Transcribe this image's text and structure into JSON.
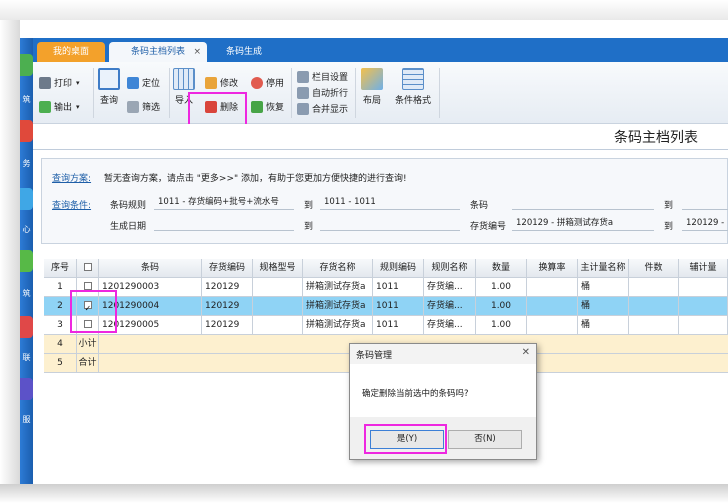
{
  "tabs": [
    {
      "label": "我的桌面"
    },
    {
      "label": "条码主档列表",
      "close": "×"
    },
    {
      "label": "条码生成"
    }
  ],
  "sidebar_chars": [
    "筑",
    "务",
    "心",
    "筑",
    "联",
    "服"
  ],
  "toolbar": {
    "print": "打印",
    "export": "输出",
    "query": "查询",
    "locate": "定位",
    "filter": "筛选",
    "import": "导入",
    "modify": "修改",
    "delete": "删除",
    "disable": "停用",
    "restore": "恢复",
    "column_settings": "栏目设置",
    "auto_wrap": "自动折行",
    "merge_display": "合并显示",
    "layout": "布局",
    "condition_format": "条件格式"
  },
  "page_title": "条码主档列表",
  "query": {
    "scheme_label": "查询方案:",
    "scheme_hint": "暂无查询方案，请点击 \"更多>>\" 添加，有助于您更加方便快捷的进行查询!",
    "condition_label": "查询条件:",
    "rule_label": "条码规则",
    "rule_value": "1011 - 存货编码+批号+流水号",
    "to1": "到",
    "rule_to_value": "1011 - 1011",
    "barcode_label": "条码",
    "to2": "到",
    "date_label": "生成日期",
    "to3": "到",
    "inv_label": "存货编号",
    "inv_value": "120129 - 拼箱测试存货a",
    "to4": "到",
    "inv_to_value": "120129 -"
  },
  "table": {
    "headers": [
      "序号",
      "",
      "条码",
      "存货编码",
      "规格型号",
      "存货名称",
      "规则编码",
      "规则名称",
      "数量",
      "换算率",
      "主计量名称",
      "件数",
      "辅计量"
    ],
    "rows": [
      {
        "seq": "1",
        "checked": false,
        "barcode": "1201290003",
        "inv_code": "120129",
        "spec": "",
        "inv_name": "拼箱测试存货a",
        "rule_code": "1011",
        "rule_name": "存货编...",
        "qty": "1.00",
        "rate": "",
        "unit": "桶",
        "pieces": "",
        "aux": ""
      },
      {
        "seq": "2",
        "checked": true,
        "barcode": "1201290004",
        "inv_code": "120129",
        "spec": "",
        "inv_name": "拼箱测试存货a",
        "rule_code": "1011",
        "rule_name": "存货编...",
        "qty": "1.00",
        "rate": "",
        "unit": "桶",
        "pieces": "",
        "aux": ""
      },
      {
        "seq": "3",
        "checked": false,
        "barcode": "1201290005",
        "inv_code": "120129",
        "spec": "",
        "inv_name": "拼箱测试存货a",
        "rule_code": "1011",
        "rule_name": "存货编...",
        "qty": "1.00",
        "rate": "",
        "unit": "桶",
        "pieces": "",
        "aux": ""
      }
    ],
    "subtotal_seq": "4",
    "subtotal_label": "小计",
    "total_seq": "5",
    "total_label": "合计"
  },
  "dialog": {
    "title": "条码管理",
    "close": "✕",
    "message": "确定删除当前选中的条码吗?",
    "yes": "是(Y)",
    "no": "否(N)"
  },
  "colors": {
    "highlight": "#ee27e0",
    "tab_home": "#f3a12b",
    "tabbar": "#1f6fc7",
    "selected_row": "#8fd3f5",
    "summary_row": "#fdf0cf"
  }
}
